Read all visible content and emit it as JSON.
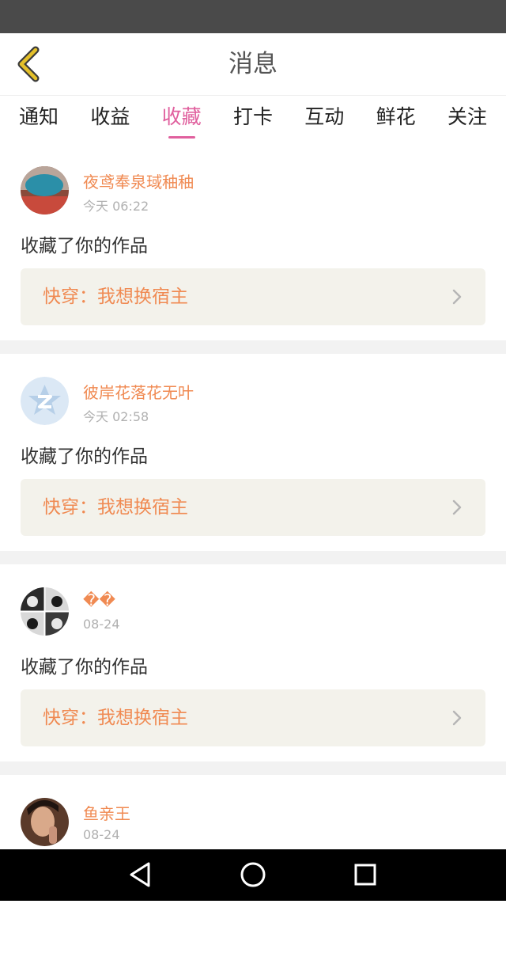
{
  "header": {
    "title": "消息",
    "back_icon": "chevron-left-icon"
  },
  "colors": {
    "accent": "#e0609e",
    "username": "#f08a52",
    "back_icon": "#e4c02a",
    "work_bg": "#f3f2eb"
  },
  "tabs": [
    {
      "label": "通知"
    },
    {
      "label": "收益"
    },
    {
      "label": "收藏",
      "active": true
    },
    {
      "label": "打卡"
    },
    {
      "label": "互动"
    },
    {
      "label": "鲜花"
    },
    {
      "label": "关注"
    }
  ],
  "messages": [
    {
      "username": "夜鸢奉泉琙秞秞",
      "time": "今天 06:22",
      "action": "收藏了你的作品",
      "work_title": "快穿：我想换宿主"
    },
    {
      "username": "彼岸花落花无叶",
      "time": "今天 02:58",
      "action": "收藏了你的作品",
      "work_title": "快穿：我想换宿主"
    },
    {
      "username": "��",
      "time": "08-24",
      "action": "收藏了你的作品",
      "work_title": "快穿：我想换宿主"
    },
    {
      "username": "鱼亲王",
      "time": "08-24"
    }
  ],
  "nav": {
    "back": "triangle-back-icon",
    "home": "circle-home-icon",
    "recent": "square-recent-icon"
  }
}
